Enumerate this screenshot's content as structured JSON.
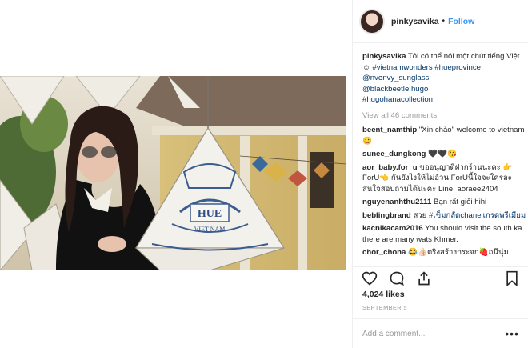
{
  "header": {
    "username": "pinkysavika",
    "separator": "•",
    "follow_label": "Follow"
  },
  "caption": {
    "username": "pinkysavika",
    "text": "Tôi có thể nói một chút tiếng Việt",
    "emoji": "☺",
    "hashtags": [
      "#vietnamwonders",
      "#hueprovince"
    ],
    "mentions": [
      "@nvenvy_sunglass",
      "@blackbeetle.hugo",
      "#hugohanacollection"
    ]
  },
  "view_all": "View all 46 comments",
  "comments": [
    {
      "user": "beent_namthip",
      "text": "\"Xin chào\" welcome to vietnam😀"
    },
    {
      "user": "sunee_dungkong",
      "text": "🖤🖤😘"
    },
    {
      "user": "aor_baby.for_u",
      "text": "ขออนุญาติฝากร้านนะคะ 👉ForU👈 กันยังไงให้ไม่อ้วน ForUนี้ใจจะใครละ สนใจสอบถามได้นะคะ Line: aoraee2404"
    },
    {
      "user": "nguyenanhthu2111",
      "text": "Bạn rất giỏi hihi"
    },
    {
      "user": "beblingbrand",
      "text": "สวย",
      "link": "#เข็มกลัดchanelเกรดพรีเมียม"
    },
    {
      "user": "kacnikacam2016",
      "text": "You should visit the south ka there are many wats Khmer."
    },
    {
      "user": "chor_chona",
      "text": "😂👍🏻ตริงสร้างกระจก🍓ถนีนุ่ม"
    }
  ],
  "actions": {
    "like_icon": "heart-icon",
    "comment_icon": "comment-icon",
    "share_icon": "share-icon",
    "save_icon": "bookmark-icon"
  },
  "likes": "4,024 likes",
  "date": "SEPTEMBER 5",
  "add_comment": {
    "placeholder": "Add a comment...",
    "more": "•••"
  },
  "photo": {
    "lantern_title": "HUE",
    "lantern_subtitle": "VIET NAM"
  },
  "colors": {
    "link": "#003569",
    "follow": "#3897f0",
    "muted": "#999999"
  }
}
